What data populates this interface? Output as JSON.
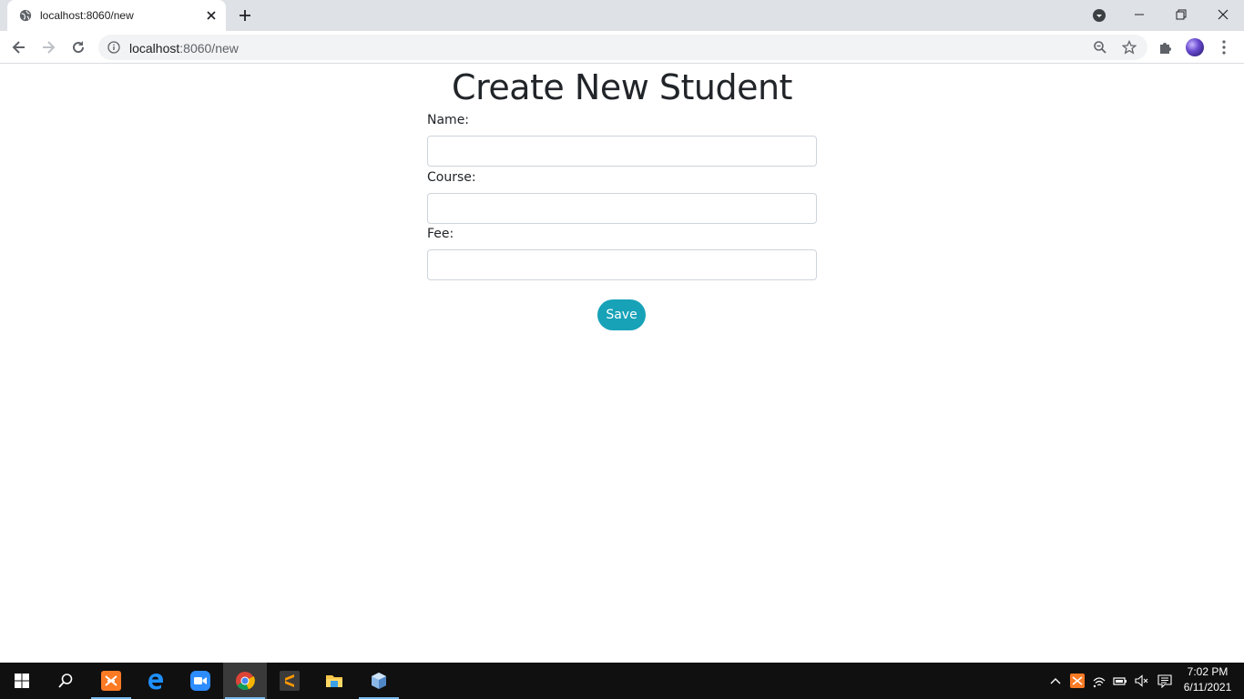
{
  "browser": {
    "tab": {
      "title": "localhost:8060/new",
      "favicon": "globe-icon"
    },
    "address": {
      "host": "localhost",
      "rest": ":8060/new"
    }
  },
  "page": {
    "title": "Create New Student",
    "fields": [
      {
        "label": "Name:",
        "value": ""
      },
      {
        "label": "Course:",
        "value": ""
      },
      {
        "label": "Fee:",
        "value": ""
      }
    ],
    "save_label": "Save",
    "colors": {
      "button": "#17a2b8",
      "text": "#212529",
      "input_border": "#ced4da"
    }
  },
  "taskbar": {
    "apps": [
      "windows-start-icon",
      "search-icon",
      "xampp-icon",
      "edge-icon",
      "zoom-icon",
      "chrome-icon",
      "sublime-text-icon",
      "file-explorer-icon",
      "virtualbox-icon"
    ],
    "clock": {
      "time": "7:02 PM",
      "date": "6/11/2021"
    }
  }
}
